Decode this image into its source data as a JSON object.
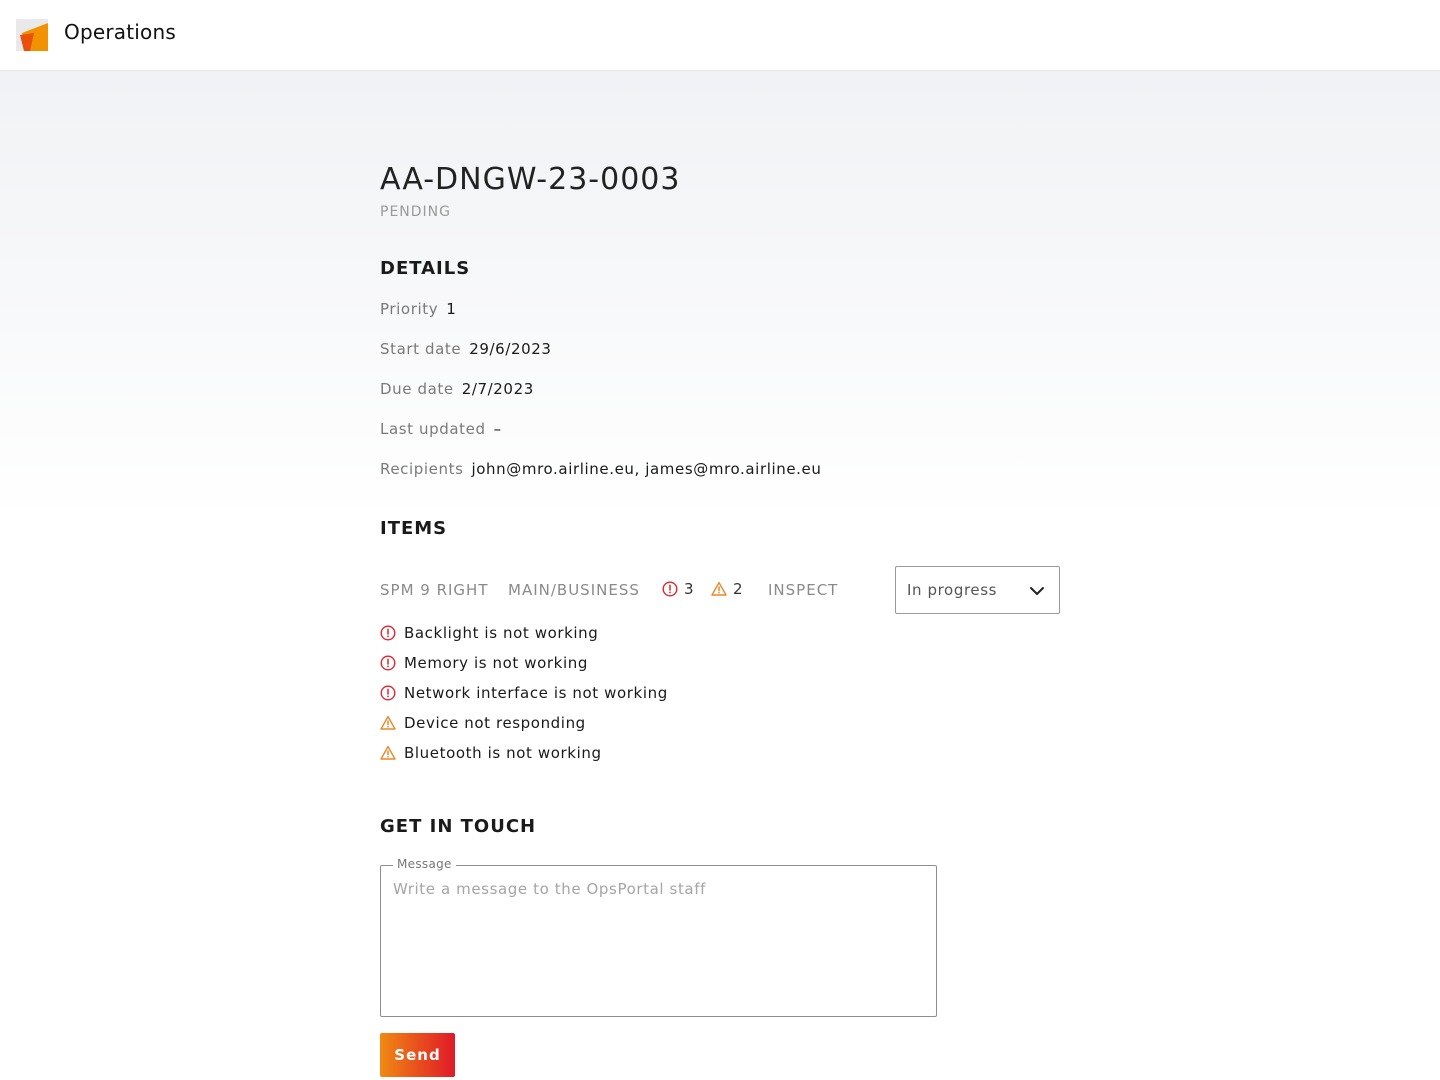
{
  "app": {
    "title": "Operations",
    "logo_icon": "operations-logo"
  },
  "ticket": {
    "id": "AA-DNGW-23-0003",
    "status": "PENDING"
  },
  "details": {
    "heading": "DETAILS",
    "priority_label": "Priority",
    "priority_value": "1",
    "start_label": "Start date",
    "start_value": "29/6/2023",
    "due_label": "Due date",
    "due_value": "2/7/2023",
    "updated_label": "Last updated",
    "updated_value": "–",
    "recipients_label": "Recipients",
    "recipients_value": "john@mro.airline.eu, james@mro.airline.eu"
  },
  "items": {
    "heading": "ITEMS",
    "location": "SPM 9 RIGHT",
    "cabin": "MAIN/BUSINESS",
    "error_count": "3",
    "warning_count": "2",
    "action": "INSPECT",
    "status_value": "In progress",
    "issues": [
      {
        "text": "Backlight is not working",
        "severity": "error"
      },
      {
        "text": "Memory is not working",
        "severity": "error"
      },
      {
        "text": "Network interface is not working",
        "severity": "error"
      },
      {
        "text": "Device not responding",
        "severity": "warning"
      },
      {
        "text": "Bluetooth is not working",
        "severity": "warning"
      }
    ]
  },
  "contact": {
    "heading": "GET IN TOUCH",
    "message_label": "Message",
    "message_placeholder": "Write a message to the OpsPortal staff",
    "message_value": "",
    "send_label": "Send"
  },
  "colors": {
    "error": "#e0242f",
    "warning": "#e8892a",
    "accent_start": "#f08a14",
    "accent_end": "#df1a2a"
  }
}
